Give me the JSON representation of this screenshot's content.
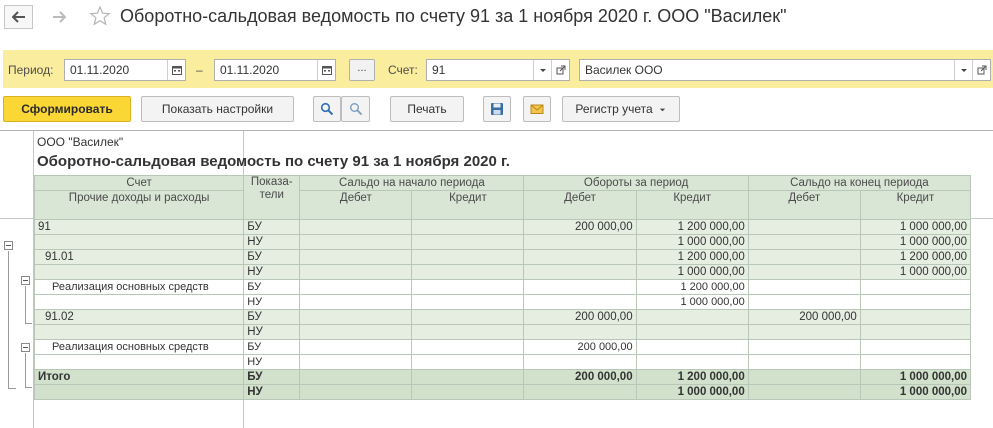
{
  "window": {
    "title": "Оборотно-сальдовая ведомость по счету 91 за 1 ноября 2020 г. ООО \"Василек\""
  },
  "params": {
    "period_label": "Период:",
    "date_from": "01.11.2020",
    "dash": "–",
    "date_to": "01.11.2020",
    "dots_label": "...",
    "account_label": "Счет:",
    "account_value": "91",
    "org_value": "Василек ООО"
  },
  "toolbar": {
    "generate": "Сформировать",
    "show_settings": "Показать настройки",
    "print": "Печать",
    "register": "Регистр учета"
  },
  "report": {
    "org": "ООО \"Василек\"",
    "title": "Оборотно-сальдовая ведомость по счету 91 за 1 ноября 2020 г.",
    "headers": {
      "account": "Счет",
      "indicators": "Показа-\nтели",
      "opening": "Сальдо на начало периода",
      "turnover": "Обороты за период",
      "closing": "Сальдо на конец периода",
      "subtitle": "Прочие доходы и расходы",
      "debit": "Дебет",
      "credit": "Кредит"
    },
    "rows": [
      {
        "account": "91",
        "ind": "БУ",
        "od": "",
        "oc": "",
        "td": "200 000,00",
        "tc": "1 200 000,00",
        "cd": "",
        "cc": "1 000 000,00",
        "kind": "g",
        "level": 0
      },
      {
        "account": "",
        "ind": "НУ",
        "od": "",
        "oc": "",
        "td": "",
        "tc": "1 000 000,00",
        "cd": "",
        "cc": "1 000 000,00",
        "kind": "g",
        "level": 0
      },
      {
        "account": "91.01",
        "ind": "БУ",
        "od": "",
        "oc": "",
        "td": "",
        "tc": "1 200 000,00",
        "cd": "",
        "cc": "1 200 000,00",
        "kind": "g",
        "level": 1
      },
      {
        "account": "",
        "ind": "НУ",
        "od": "",
        "oc": "",
        "td": "",
        "tc": "1 000 000,00",
        "cd": "",
        "cc": "1 000 000,00",
        "kind": "g",
        "level": 1
      },
      {
        "account": "Реализация основных средств",
        "ind": "БУ",
        "od": "",
        "oc": "",
        "td": "",
        "tc": "1 200 000,00",
        "cd": "",
        "cc": "",
        "kind": "w",
        "level": 2
      },
      {
        "account": "",
        "ind": "НУ",
        "od": "",
        "oc": "",
        "td": "",
        "tc": "1 000 000,00",
        "cd": "",
        "cc": "",
        "kind": "w",
        "level": 2
      },
      {
        "account": "91.02",
        "ind": "БУ",
        "od": "",
        "oc": "",
        "td": "200 000,00",
        "tc": "",
        "cd": "200 000,00",
        "cc": "",
        "kind": "g",
        "level": 1
      },
      {
        "account": "",
        "ind": "НУ",
        "od": "",
        "oc": "",
        "td": "",
        "tc": "",
        "cd": "",
        "cc": "",
        "kind": "g",
        "level": 1
      },
      {
        "account": "Реализация основных средств",
        "ind": "БУ",
        "od": "",
        "oc": "",
        "td": "200 000,00",
        "tc": "",
        "cd": "",
        "cc": "",
        "kind": "w",
        "level": 2
      },
      {
        "account": "",
        "ind": "НУ",
        "od": "",
        "oc": "",
        "td": "",
        "tc": "",
        "cd": "",
        "cc": "",
        "kind": "w",
        "level": 2
      },
      {
        "account": "Итого",
        "ind": "БУ",
        "od": "",
        "oc": "",
        "td": "200 000,00",
        "tc": "1 200 000,00",
        "cd": "",
        "cc": "1 000 000,00",
        "kind": "t",
        "level": 0
      },
      {
        "account": "",
        "ind": "НУ",
        "od": "",
        "oc": "",
        "td": "",
        "tc": "1 000 000,00",
        "cd": "",
        "cc": "1 000 000,00",
        "kind": "t",
        "level": 0
      }
    ]
  },
  "icons": {
    "back": "arrow-left-icon",
    "forward": "arrow-right-icon",
    "favorite": "star-icon",
    "calendar": "calendar-icon",
    "dropdown": "chevron-down-icon",
    "open": "open-form-icon",
    "search": "search-icon",
    "search_cancel": "search-cancel-icon",
    "save": "save-icon",
    "mail": "mail-icon"
  },
  "colors": {
    "params_bg": "#fbed9e",
    "primary_button": "#fbd736",
    "header_bg": "#d9e6d6",
    "group_row_bg": "#e6eee2",
    "total_row_bg": "#d2e1cc"
  }
}
